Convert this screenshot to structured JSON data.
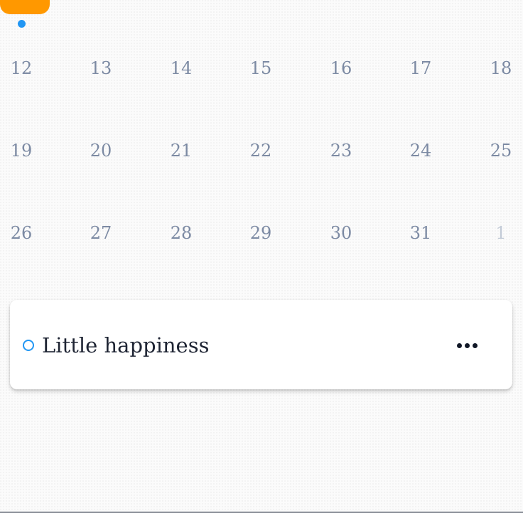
{
  "calendar": {
    "weeks": [
      [
        "12",
        "13",
        "14",
        "15",
        "16",
        "17",
        "18"
      ],
      [
        "19",
        "20",
        "21",
        "22",
        "23",
        "24",
        "25"
      ],
      [
        "26",
        "27",
        "28",
        "29",
        "30",
        "31",
        "1"
      ]
    ],
    "next_month_days": [
      "1"
    ]
  },
  "event": {
    "title": "Little happiness",
    "status_icon": "circle-outline-icon",
    "menu_icon": "more-horizontal-icon"
  },
  "colors": {
    "selected_day": "#ff9800",
    "event_dot": "#2196f3",
    "day_text": "#7c8aa3",
    "next_month_text": "#c2cad6",
    "title_text": "#1e2433"
  }
}
